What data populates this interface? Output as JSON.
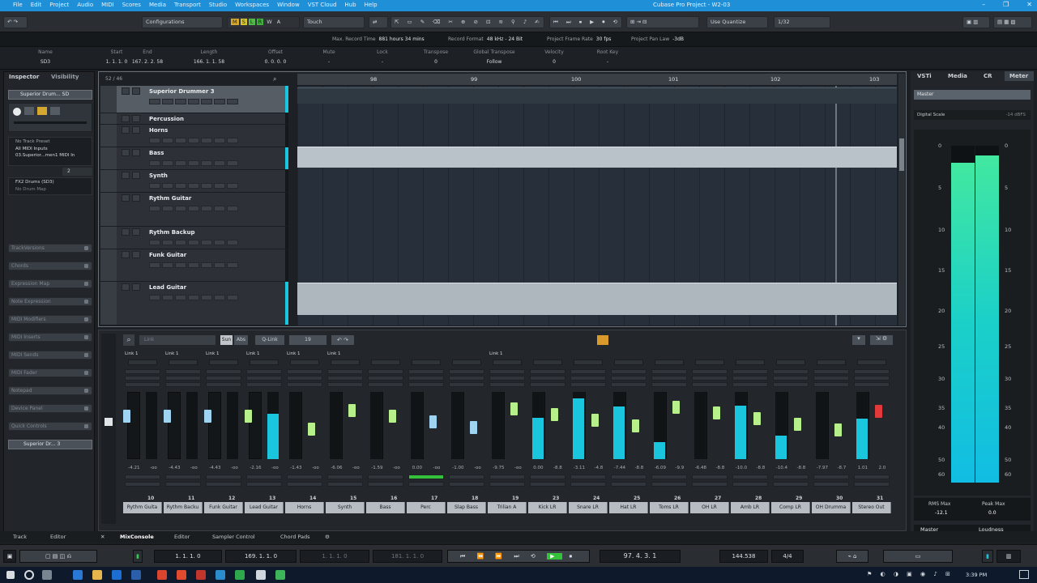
{
  "titlebar": {
    "menus": [
      "File",
      "Edit",
      "Project",
      "Audio",
      "MIDI",
      "Scores",
      "Media",
      "Transport",
      "Studio",
      "Workspaces",
      "Window",
      "VST Cloud",
      "Hub",
      "Help"
    ],
    "title": "Cubase Pro Project - W2-03"
  },
  "toolbar": {
    "configurations": "Configurations",
    "automation_mode": "Touch",
    "quantize": "Use Quantize",
    "quantize_value": "1/32",
    "mode_buttons": [
      "M",
      "S",
      "L",
      "R",
      "W",
      "A"
    ]
  },
  "infoline": [
    {
      "label": "Max. Record Time",
      "value": "881 hours 34 mins"
    },
    {
      "label": "Record Format",
      "value": "48 kHz - 24 Bit"
    },
    {
      "label": "Project Frame Rate",
      "value": "30 fps"
    },
    {
      "label": "Project Pan Law",
      "value": "-3dB"
    }
  ],
  "trackinfo": [
    {
      "label": "Name",
      "value": "SD3"
    },
    {
      "label": "Start",
      "value": "1. 1. 1. 0"
    },
    {
      "label": "End",
      "value": "167. 2. 2. 58"
    },
    {
      "label": "Length",
      "value": "166. 1. 1. 58"
    },
    {
      "label": "Offset",
      "value": "0. 0. 0. 0"
    },
    {
      "label": "Mute",
      "value": "-"
    },
    {
      "label": "Lock",
      "value": "-"
    },
    {
      "label": "Transpose",
      "value": "0"
    },
    {
      "label": "Global Transpose",
      "value": "Follow"
    },
    {
      "label": "Velocity",
      "value": "0"
    },
    {
      "label": "Root Key",
      "value": "-"
    }
  ],
  "inspector": {
    "tabs": [
      "Inspector",
      "Visibility"
    ],
    "instrument": "Superior Drum... SD",
    "io": [
      "No Track Preset",
      "All MIDI Inputs",
      "03.Superior...men1 MIDI In"
    ],
    "drum_map": "FX2 Drums (SD3)",
    "drum_map_sub": "No Drum Map",
    "channel_value": "2",
    "sections": [
      "TrackVersions",
      "Chords",
      "Expression Map",
      "Note Expression",
      "MIDI Modifiers",
      "MIDI Inserts",
      "MIDI Sends",
      "MIDI Fader",
      "Notepad",
      "Device Panel",
      "Quick Controls"
    ],
    "bottom_track": "Superior Dr... 3"
  },
  "tracks": [
    {
      "name": "Superior Drummer 3"
    },
    {
      "name": "Percussion"
    },
    {
      "name": "Horns"
    },
    {
      "name": "Bass"
    },
    {
      "name": "Synth"
    },
    {
      "name": "Rythm Guitar"
    },
    {
      "name": "Rythm Backup"
    },
    {
      "name": "Funk Guitar"
    },
    {
      "name": "Lead Guitar"
    }
  ],
  "project_header": "52 / 46",
  "ruler": [
    "98",
    "99",
    "100",
    "101",
    "102",
    "103"
  ],
  "mixer": {
    "toolbar": [
      "Link",
      "Sun",
      "Abs",
      "Q-Link",
      "19"
    ],
    "channels": [
      {
        "num": "10",
        "name": "Rythm Guita",
        "label": "Link 1",
        "vals": [
          "-4.21",
          "-oo"
        ],
        "meter": 0
      },
      {
        "num": "11",
        "name": "Rythm Backu",
        "label": "Link 1",
        "vals": [
          "-4.43",
          "-oo"
        ],
        "meter": 0
      },
      {
        "num": "12",
        "name": "Funk Guitar",
        "label": "Link 1",
        "vals": [
          "-4.43",
          "-oo"
        ],
        "meter": 0
      },
      {
        "num": "13",
        "name": "Lead Guitar",
        "label": "Link 1",
        "vals": [
          "-2.16",
          "-oo"
        ],
        "meter": 0.67
      },
      {
        "num": "14",
        "name": "Horns",
        "label": "Link 1",
        "vals": [
          "-1.43",
          "-oo"
        ],
        "meter": 0
      },
      {
        "num": "15",
        "name": "Synth",
        "label": "Link 1",
        "vals": [
          "-6.06",
          "-oo"
        ],
        "meter": 0
      },
      {
        "num": "16",
        "name": "Bass",
        "label": "",
        "vals": [
          "-1.59",
          "-oo"
        ],
        "meter": 0
      },
      {
        "num": "17",
        "name": "Perc",
        "label": "",
        "vals": [
          "0.00",
          "-oo"
        ],
        "meter": 0
      },
      {
        "num": "18",
        "name": "Slap Bass",
        "label": "",
        "vals": [
          "-1.00",
          "-oo"
        ],
        "meter": 0
      },
      {
        "num": "19",
        "name": "Trilian A",
        "label": "Link 1",
        "vals": [
          "-9.75",
          "-oo"
        ],
        "meter": 0
      },
      {
        "num": "23",
        "name": "Kick LR",
        "label": "",
        "vals": [
          "0.00",
          "-8.8"
        ],
        "meter": 0.62
      },
      {
        "num": "24",
        "name": "Snare LR",
        "label": "",
        "vals": [
          "-3.11",
          "-4.8"
        ],
        "meter": 0.9
      },
      {
        "num": "25",
        "name": "Hat LR",
        "label": "",
        "vals": [
          "-7.44",
          "-8.8"
        ],
        "meter": 0.78
      },
      {
        "num": "26",
        "name": "Toms LR",
        "label": "",
        "vals": [
          "-6.09",
          "-9.9"
        ],
        "meter": 0.25
      },
      {
        "num": "27",
        "name": "OH LR",
        "label": "",
        "vals": [
          "-6.48",
          "-8.8"
        ],
        "meter": 0
      },
      {
        "num": "28",
        "name": "Amb LR",
        "label": "",
        "vals": [
          "-10.0",
          "-8.8"
        ],
        "meter": 0.8
      },
      {
        "num": "29",
        "name": "Comp LR",
        "label": "",
        "vals": [
          "-10.4",
          "-8.8"
        ],
        "meter": 0.35
      },
      {
        "num": "30",
        "name": "OH Drumma",
        "label": "",
        "vals": [
          "-7.97",
          "-8.7"
        ],
        "meter": 0
      },
      {
        "num": "31",
        "name": "Stereo Out",
        "label": "",
        "vals": [
          "1.01",
          "2.0"
        ],
        "meter": 0.6
      }
    ]
  },
  "rightpanel": {
    "tabs": [
      "VSTi",
      "Media",
      "CR",
      "Meter"
    ],
    "header": "Master",
    "scale_label": "Digital Scale",
    "scale_value": "-14 dBFS",
    "scale": [
      "0",
      "5",
      "10",
      "15",
      "20",
      "25",
      "30",
      "35",
      "40",
      "50",
      "60"
    ],
    "rms_label": "RMS Max",
    "rms_value": "-12.1",
    "peak_label": "Peak Max",
    "peak_value": "0.0",
    "bottom_tabs": [
      "Master",
      "Loudness"
    ],
    "level_left": 0.95,
    "level_right": 0.97
  },
  "bottomtabs": [
    "Track",
    "Editor",
    "MixConsole",
    "Editor",
    "Sampler Control",
    "Chord Pads"
  ],
  "transport": {
    "left_locator": "1. 1. 1. 0",
    "right_locator": "169. 1. 1. 0",
    "punch": "1. 1. 1. 0",
    "punch2": "181. 1. 1. 0",
    "position": "97. 4. 3. 1",
    "tempo": "144.538",
    "signature": "4/4"
  },
  "taskbar": {
    "clock": "3:39 PM"
  },
  "colors": {
    "accent": "#1f8fd8",
    "meter": "#19c6de",
    "fader_cap_blue": "#9fd3f2",
    "fader_cap_green": "#b7f08a",
    "fader_cap_red": "#e23a3a"
  }
}
